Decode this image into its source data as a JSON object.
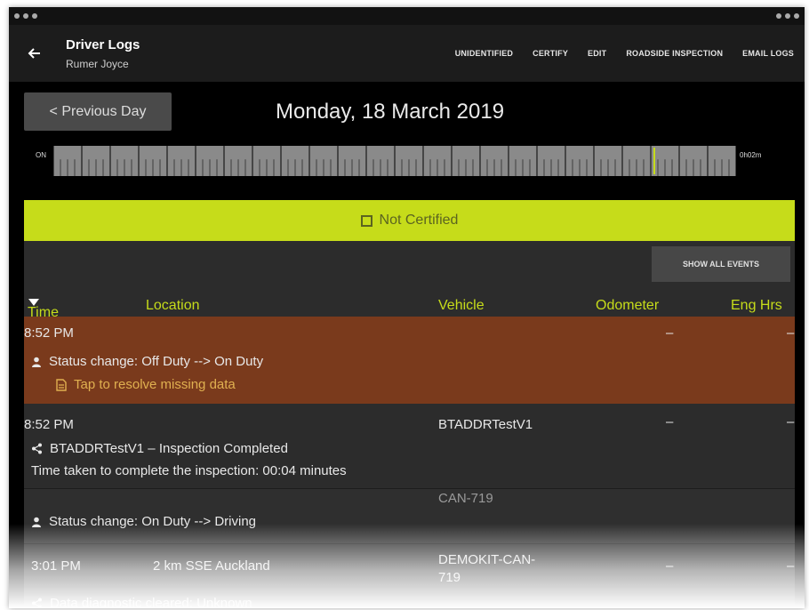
{
  "status_bar": {
    "left": "",
    "right": ""
  },
  "app_bar": {
    "title": "Driver Logs",
    "subtitle": "Rumer Joyce",
    "actions": [
      "UNIDENTIFIED",
      "CERTIFY",
      "EDIT",
      "ROADSIDE INSPECTION",
      "EMAIL LOGS"
    ]
  },
  "day": {
    "prev_label": "< Previous Day",
    "date": "Monday, 18 March 2019"
  },
  "timeline": {
    "left_label": "ON",
    "right_label": "0h02m"
  },
  "certification": {
    "label": "Not Certified"
  },
  "events": {
    "show_all_label": "SHOW ALL EVENTS",
    "columns": {
      "time": "Time",
      "location": "Location",
      "vehicle": "Vehicle",
      "odometer": "Odometer",
      "eng_hrs": "Eng Hrs"
    },
    "rows": [
      {
        "time": "8:52 PM",
        "status": "Status change: Off Duty --> On Duty",
        "note": "Tap to resolve missing data",
        "odometer": "–",
        "eng_hrs": "–"
      },
      {
        "time": "8:52 PM",
        "vehicle": "BTADDRTestV1",
        "status": "BTADDRTestV1 – Inspection Completed",
        "detail": "Time taken to complete the inspection: 00:04 minutes",
        "odometer": "–",
        "eng_hrs": "–"
      },
      {
        "vehicle": "CAN-719",
        "status": "Status change: On Duty --> Driving"
      },
      {
        "time": "3:01 PM",
        "location": "2 km SSE Auckland",
        "vehicle": "DEMOKIT-CAN-719",
        "odometer": "–",
        "eng_hrs": "–",
        "status": "Data diagnostic cleared: Unknown"
      }
    ]
  },
  "colors": {
    "accent": "#c6dc1a",
    "missing_row": "#7a3a1c",
    "panel": "#2c2c2c",
    "warning_text": "#e0b050"
  }
}
